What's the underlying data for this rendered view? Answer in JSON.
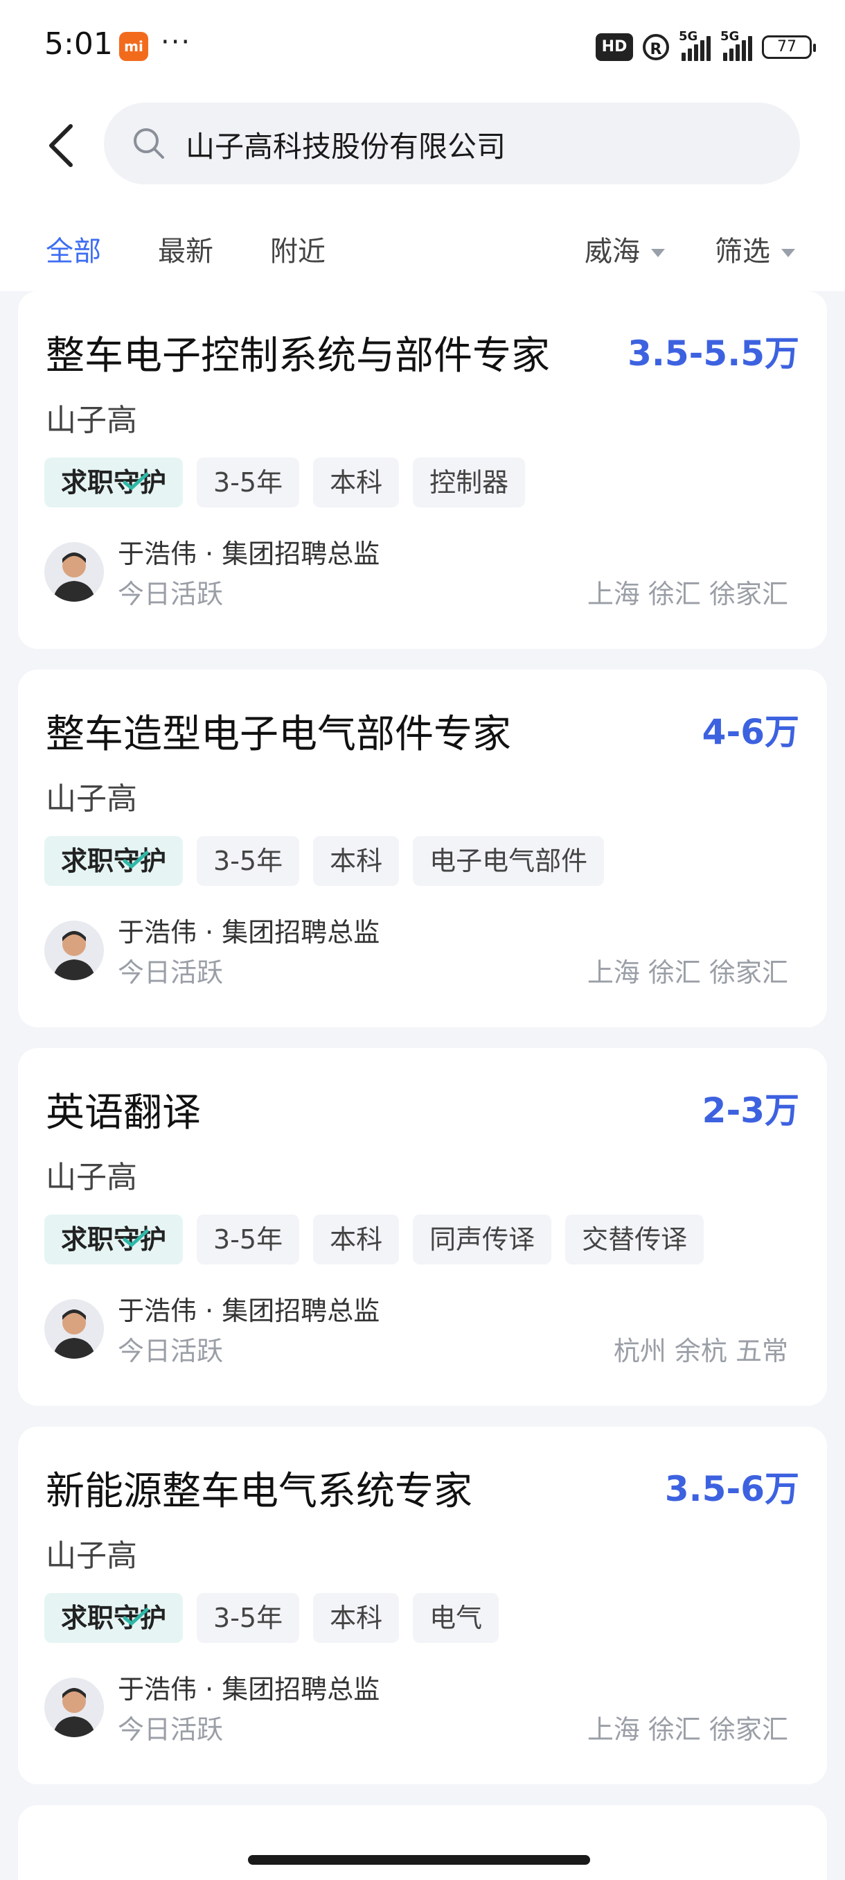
{
  "status_bar": {
    "time": "5:01",
    "mi_badge": "mi",
    "dots": "···",
    "hd": "HD",
    "r": "R",
    "net1": "5G",
    "net2": "5G",
    "battery": "77"
  },
  "search": {
    "query": "山子高科技股份有限公司"
  },
  "tabs": [
    {
      "label": "全部",
      "active": true
    },
    {
      "label": "最新",
      "active": false
    },
    {
      "label": "附近",
      "active": false
    }
  ],
  "filters": {
    "city": "威海",
    "filter": "筛选"
  },
  "colors": {
    "accent": "#3d6df2",
    "salary": "#3d62e0",
    "guard_tag_bg": "#e6f5f4"
  },
  "jobs": [
    {
      "title": "整车电子控制系统与部件专家",
      "salary": "3.5-5.5万",
      "company": "山子高",
      "guard_tag": "求职守护",
      "tags": [
        "3-5年",
        "本科",
        "控制器"
      ],
      "recruiter": "于浩伟 · 集团招聘总监",
      "active": "今日活跃",
      "location": "上海 徐汇 徐家汇"
    },
    {
      "title": "整车造型电子电气部件专家",
      "salary": "4-6万",
      "company": "山子高",
      "guard_tag": "求职守护",
      "tags": [
        "3-5年",
        "本科",
        "电子电气部件"
      ],
      "recruiter": "于浩伟 · 集团招聘总监",
      "active": "今日活跃",
      "location": "上海 徐汇 徐家汇"
    },
    {
      "title": "英语翻译",
      "salary": "2-3万",
      "company": "山子高",
      "guard_tag": "求职守护",
      "tags": [
        "3-5年",
        "本科",
        "同声传译",
        "交替传译"
      ],
      "recruiter": "于浩伟 · 集团招聘总监",
      "active": "今日活跃",
      "location": "杭州 余杭 五常"
    },
    {
      "title": "新能源整车电气系统专家",
      "salary": "3.5-6万",
      "company": "山子高",
      "guard_tag": "求职守护",
      "tags": [
        "3-5年",
        "本科",
        "电气"
      ],
      "recruiter": "于浩伟 · 集团招聘总监",
      "active": "今日活跃",
      "location": "上海 徐汇 徐家汇"
    }
  ]
}
